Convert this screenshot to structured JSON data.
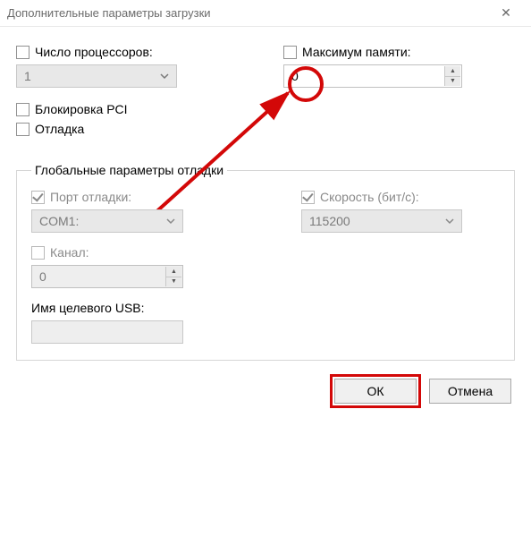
{
  "titlebar": {
    "title": "Дополнительные параметры загрузки",
    "close": "✕"
  },
  "top": {
    "cpu_label": "Число процессоров:",
    "cpu_value": "1",
    "mem_label": "Максимум памяти:",
    "mem_value": "0",
    "pci_label": "Блокировка PCI",
    "debug_label": "Отладка"
  },
  "group": {
    "legend": "Глобальные параметры отладки",
    "port_label": "Порт отладки:",
    "port_value": "COM1:",
    "baud_label": "Скорость (бит/с):",
    "baud_value": "115200",
    "channel_label": "Канал:",
    "channel_value": "0",
    "usb_label": "Имя целевого USB:"
  },
  "buttons": {
    "ok": "ОК",
    "cancel": "Отмена"
  }
}
